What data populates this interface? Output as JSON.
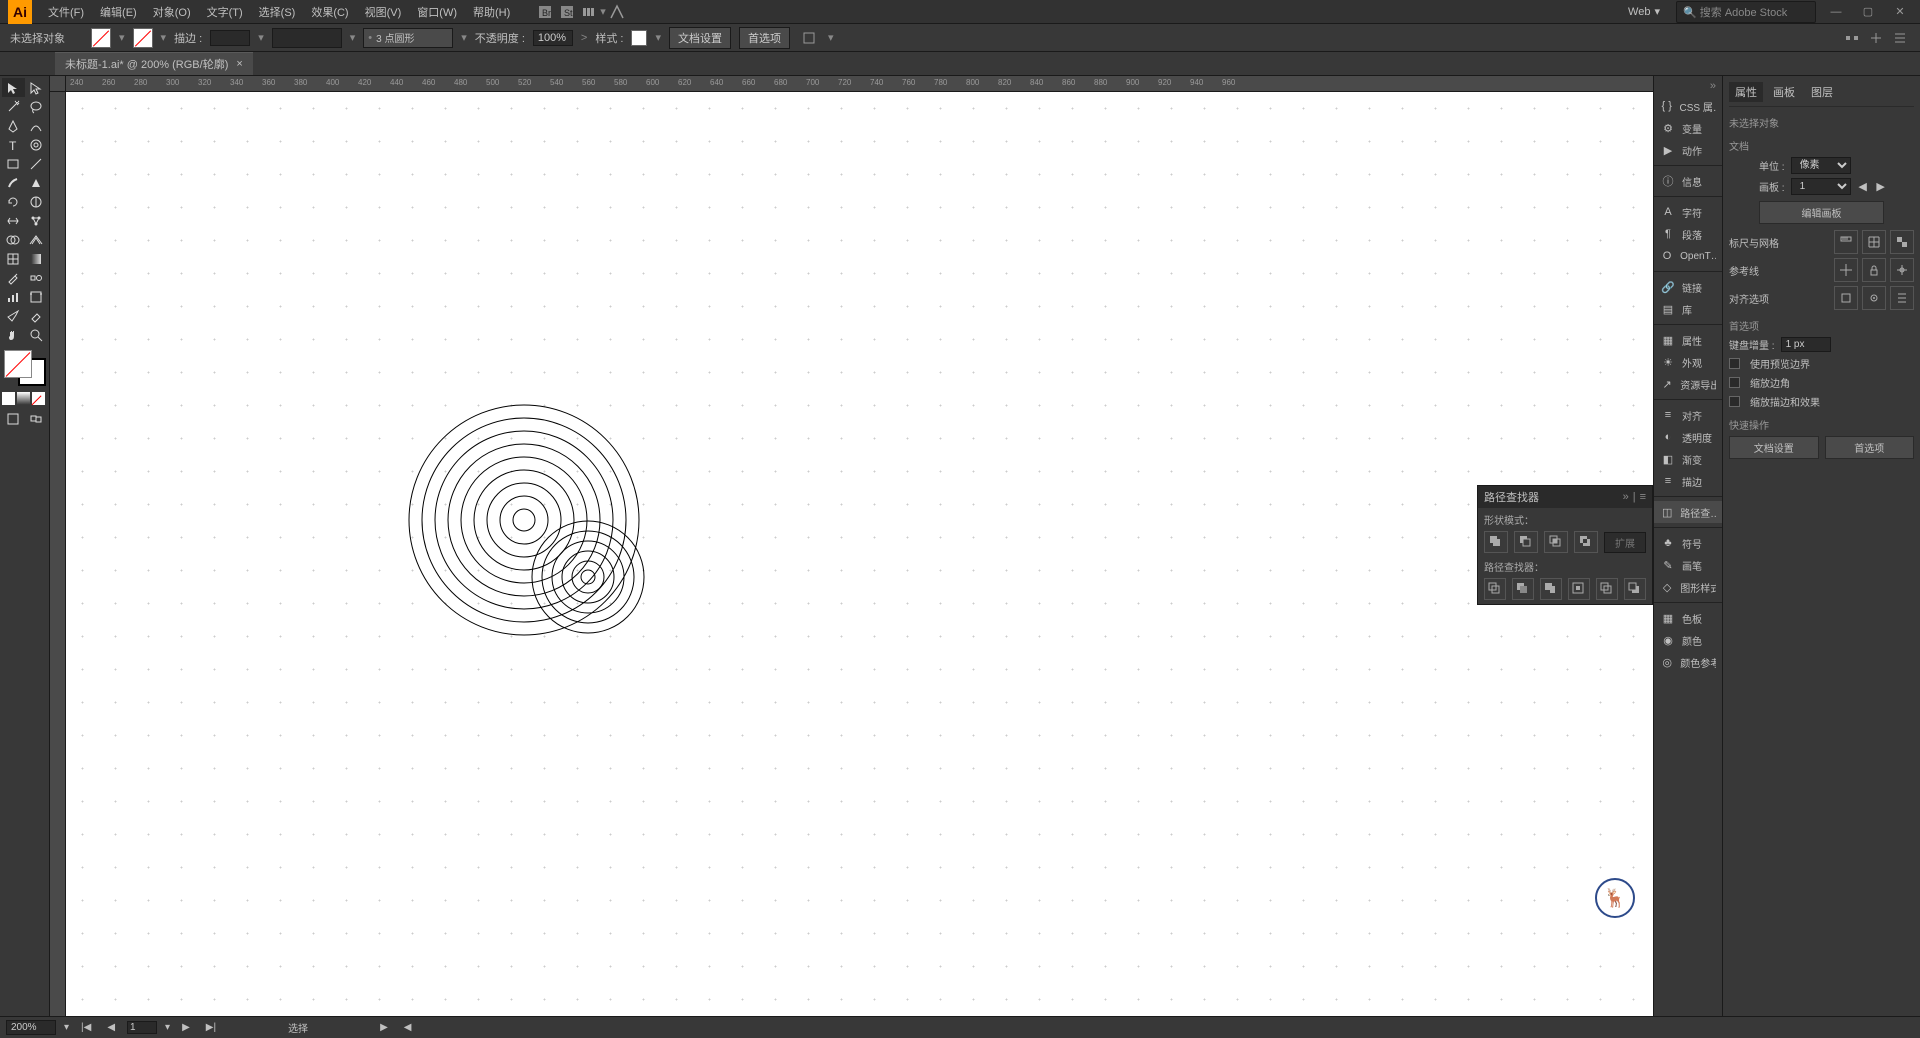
{
  "menubar": {
    "items": [
      "文件(F)",
      "编辑(E)",
      "对象(O)",
      "文字(T)",
      "选择(S)",
      "效果(C)",
      "视图(V)",
      "窗口(W)",
      "帮助(H)"
    ],
    "workspace": "Web",
    "search_placeholder": "搜索 Adobe Stock"
  },
  "ctrlbar": {
    "selection": "未选择对象",
    "stroke_label": "描边 :",
    "stroke_value": "",
    "profile_label": "3 点圆形",
    "opacity_label": "不透明度 :",
    "opacity_value": "100%",
    "style_label": "样式 :",
    "doc_setup": "文档设置",
    "prefs": "首选项"
  },
  "tab": {
    "title": "未标题-1.ai* @ 200% (RGB/轮廓)"
  },
  "ruler": {
    "h_ticks": [
      240,
      260,
      280,
      300,
      320,
      340,
      360,
      380,
      400,
      420,
      440,
      460,
      480,
      500,
      520,
      540,
      560,
      580,
      600,
      620,
      640,
      660,
      680,
      700,
      720,
      740,
      760,
      780,
      800,
      820,
      840,
      860,
      880,
      900,
      920,
      940,
      960
    ]
  },
  "panel_strip": {
    "items": [
      "CSS 属…",
      "变量",
      "动作",
      "",
      "信息",
      "",
      "字符",
      "段落",
      "OpenT…",
      "",
      "链接",
      "库",
      "",
      "属性",
      "外观",
      "资源导出",
      "",
      "对齐",
      "透明度",
      "渐变",
      "描边",
      "",
      "路径查…",
      "",
      "符号",
      "画笔",
      "图形样式",
      "",
      "色板",
      "颜色",
      "颜色参考"
    ]
  },
  "props": {
    "tabs": [
      "属性",
      "画板",
      "图层"
    ],
    "selection": "未选择对象",
    "doc_label": "文档",
    "unit_label": "单位 :",
    "unit_value": "像素",
    "artboard_label": "画板 :",
    "artboard_value": "1",
    "edit_artboard": "编辑画板",
    "ruler_grid_label": "标尺与网格",
    "guides_label": "参考线",
    "align_label": "对齐选项",
    "prefs_label": "首选项",
    "key_inc_label": "键盘增量 :",
    "key_inc_value": "1 px",
    "chk1": "使用预览边界",
    "chk2": "缩放边角",
    "chk3": "缩放描边和效果",
    "quick_label": "快速操作",
    "doc_setup_btn": "文档设置",
    "prefs_btn": "首选项"
  },
  "pathfinder": {
    "title": "路径查找器",
    "shape_mode": "形状模式：",
    "pf_label": "路径查找器：",
    "expand": "扩展"
  },
  "statusbar": {
    "zoom": "200%",
    "artboard": "1",
    "tool": "选择"
  }
}
